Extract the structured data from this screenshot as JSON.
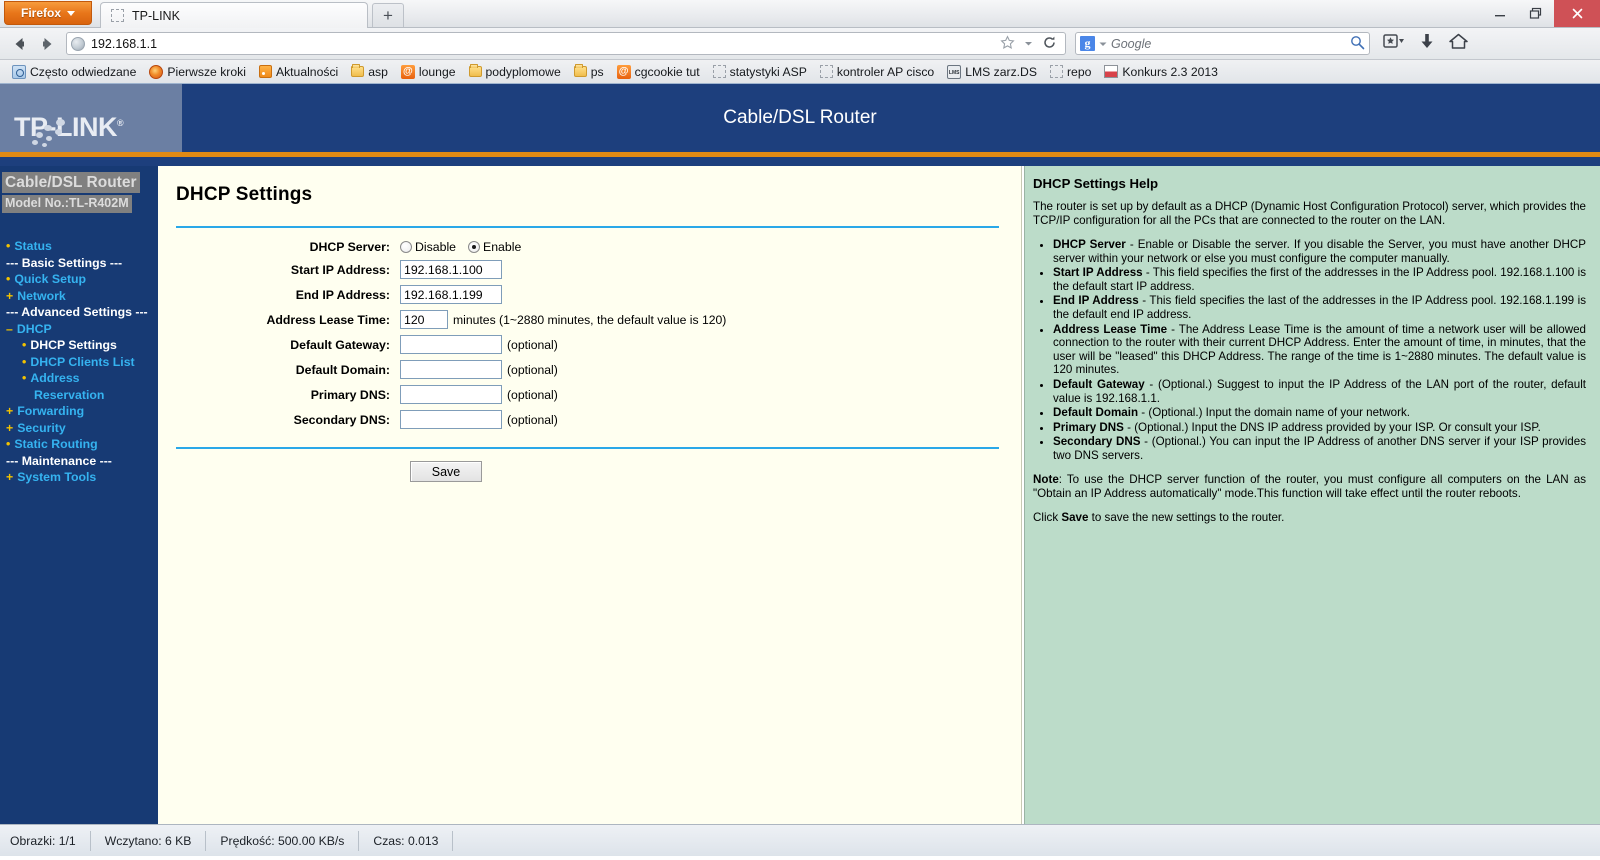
{
  "browser": {
    "app_button": "Firefox",
    "tab_title": "TP-LINK",
    "new_tab_label": "+",
    "url": "192.168.1.1",
    "search_placeholder": "Google",
    "search_engine": "g",
    "window_minimize": "–",
    "window_restore": "❐",
    "window_close": "✕",
    "bookmarks": [
      {
        "label": "Często odwiedzane",
        "icon": "most-visited-icon",
        "icon_kind": "blue"
      },
      {
        "label": "Pierwsze kroki",
        "icon": "firefox-icon",
        "icon_kind": "fox"
      },
      {
        "label": "Aktualności",
        "icon": "rss-feed-icon",
        "icon_kind": "rss"
      },
      {
        "label": "asp",
        "icon": "folder-icon",
        "icon_kind": "folder"
      },
      {
        "label": "lounge",
        "icon": "lounge-site-icon",
        "icon_kind": "cg"
      },
      {
        "label": "podyplomowe",
        "icon": "folder-icon",
        "icon_kind": "folder"
      },
      {
        "label": "ps",
        "icon": "folder-icon",
        "icon_kind": "folder"
      },
      {
        "label": "cgcookie tut",
        "icon": "cgcookie-icon",
        "icon_kind": "cg"
      },
      {
        "label": "statystyki ASP",
        "icon": "blank-favicon-icon",
        "icon_kind": "dashed"
      },
      {
        "label": "kontroler AP cisco",
        "icon": "blank-favicon-icon",
        "icon_kind": "dashed"
      },
      {
        "label": "LMS zarz.DS",
        "icon": "lms-icon",
        "icon_kind": "lms"
      },
      {
        "label": "repo",
        "icon": "blank-favicon-icon",
        "icon_kind": "dashed"
      },
      {
        "label": "Konkurs 2.3 2013",
        "icon": "flag-icon",
        "icon_kind": "flag"
      }
    ]
  },
  "router": {
    "brand": "TP-LINK",
    "header_title": "Cable/DSL Router",
    "sidebar": {
      "device_name": "Cable/DSL Router",
      "model": "Model No.:TL-R402M",
      "items": [
        {
          "label": "Status",
          "type": "link",
          "marker": "•"
        },
        {
          "label": "--- Basic Settings ---",
          "type": "separator",
          "marker": ""
        },
        {
          "label": "Quick Setup",
          "type": "link",
          "marker": "•"
        },
        {
          "label": "Network",
          "type": "link",
          "marker": "+"
        },
        {
          "label": "--- Advanced Settings ---",
          "type": "separator",
          "marker": ""
        },
        {
          "label": "DHCP",
          "type": "link",
          "marker": "–"
        },
        {
          "label": "DHCP Settings",
          "type": "current",
          "marker": "•",
          "sub": true
        },
        {
          "label": "DHCP Clients List",
          "type": "link",
          "marker": "•",
          "sub": true
        },
        {
          "label": "Address Reservation",
          "type": "link",
          "marker": "•",
          "sub": true,
          "line1": "Address",
          "line2": "Reservation"
        },
        {
          "label": "Forwarding",
          "type": "link",
          "marker": "+"
        },
        {
          "label": "Security",
          "type": "link",
          "marker": "+"
        },
        {
          "label": "Static Routing",
          "type": "link",
          "marker": "•"
        },
        {
          "label": "--- Maintenance ---",
          "type": "separator",
          "marker": ""
        },
        {
          "label": "System Tools",
          "type": "link",
          "marker": "+"
        }
      ]
    },
    "page_title": "DHCP Settings",
    "form": {
      "dhcp_server_label": "DHCP Server:",
      "dhcp_disable_label": "Disable",
      "dhcp_enable_label": "Enable",
      "dhcp_selected": "Enable",
      "start_ip_label": "Start IP Address:",
      "start_ip_value": "192.168.1.100",
      "end_ip_label": "End IP Address:",
      "end_ip_value": "192.168.1.199",
      "lease_label": "Address Lease Time:",
      "lease_value": "120",
      "lease_hint": "minutes (1~2880 minutes, the default value is 120)",
      "gateway_label": "Default Gateway:",
      "gateway_value": "",
      "domain_label": "Default Domain:",
      "domain_value": "",
      "primary_dns_label": "Primary DNS:",
      "primary_dns_value": "",
      "secondary_dns_label": "Secondary DNS:",
      "secondary_dns_value": "",
      "optional_hint": "(optional)",
      "save_label": "Save"
    },
    "help": {
      "title": "DHCP Settings Help",
      "intro": "The router is set up by default as a DHCP (Dynamic Host Configuration Protocol) server, which provides the TCP/IP configuration for all the PCs that are connected to the router on the LAN.",
      "items": [
        {
          "term": "DHCP Server",
          "text": " - Enable or Disable the server. If you disable the Server, you must have another DHCP server within your network or else you must configure the computer manually."
        },
        {
          "term": "Start IP Address",
          "text": " - This field specifies the first of the addresses in the IP Address pool. 192.168.1.100 is the default start IP address."
        },
        {
          "term": "End IP Address",
          "text": " - This field specifies the last of the addresses in the IP Address pool. 192.168.1.199 is the default end IP address."
        },
        {
          "term": "Address Lease Time",
          "text": " - The Address Lease Time is the amount of time a network user will be allowed connection to the router with their current DHCP Address. Enter the amount of time, in minutes, that the user will be \"leased\" this DHCP Address. The range of the time is 1~2880 minutes. The default value is 120 minutes."
        },
        {
          "term": "Default Gateway",
          "text": " - (Optional.) Suggest to input the IP Address of the LAN port of the router, default value is 192.168.1.1."
        },
        {
          "term": "Default Domain",
          "text": " - (Optional.) Input the domain name of your network."
        },
        {
          "term": "Primary DNS",
          "text": " - (Optional.) Input the DNS IP address provided by your ISP. Or consult your ISP."
        },
        {
          "term": "Secondary DNS",
          "text": " - (Optional.) You can input the IP Address of another DNS server if your ISP provides two DNS servers."
        }
      ],
      "note_label": "Note",
      "note_text": ": To use the DHCP server function of the router, you must configure all computers on the LAN as \"Obtain an IP Address automatically\" mode.This function will take effect until the router reboots.",
      "click_prefix": "Click ",
      "click_bold": "Save",
      "click_suffix": " to save the new settings to the router."
    }
  },
  "statusbar": {
    "images": "Obrazki: 1/1",
    "loaded": "Wczytano: 6 KB",
    "speed": "Prędkość: 500.00 KB/s",
    "time": "Czas: 0.013"
  },
  "colors": {
    "header_navy": "#1d3f7d",
    "accent_orange": "#e08a14",
    "sidebar_navy": "#173a74",
    "link_blue": "#35b3f0",
    "help_green": "#bcdcc9",
    "rule_blue": "#2aa8e8",
    "content_cream": "#fffff0"
  }
}
